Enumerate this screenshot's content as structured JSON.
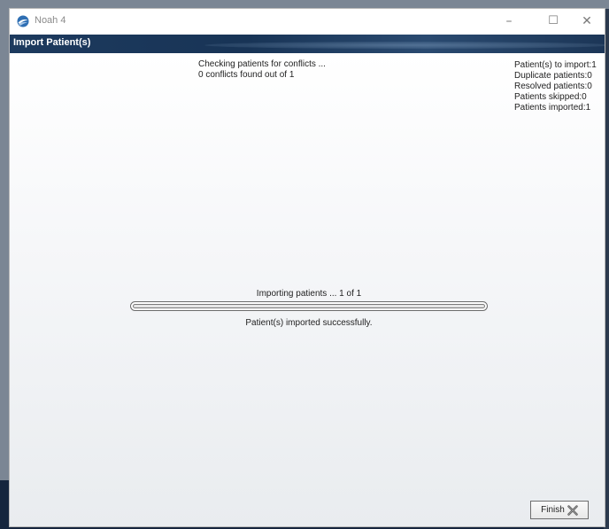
{
  "window": {
    "title": "Noah 4",
    "app_icon": "noah-logo-icon",
    "controls": {
      "minimize": "–",
      "maximize": "☐",
      "close": "✕"
    }
  },
  "dialog": {
    "title": "Import Patient(s)"
  },
  "conflicts": {
    "checking": "Checking patients for conflicts ...",
    "found": "0 conflicts found out of 1"
  },
  "stats": [
    {
      "label": "Patient(s) to import:",
      "value": "1"
    },
    {
      "label": "Duplicate patients:",
      "value": "0"
    },
    {
      "label": "Resolved patients:",
      "value": "0"
    },
    {
      "label": "Patients skipped:",
      "value": "0"
    },
    {
      "label": "Patients imported:",
      "value": "1"
    }
  ],
  "progress": {
    "label": "Importing patients ... 1 of 1",
    "fraction": 1.0,
    "result": "Patient(s) imported successfully."
  },
  "finish_button": {
    "label": "Finish",
    "icon": "finish-x-icon"
  },
  "colors": {
    "header": "#1d3a5e"
  }
}
